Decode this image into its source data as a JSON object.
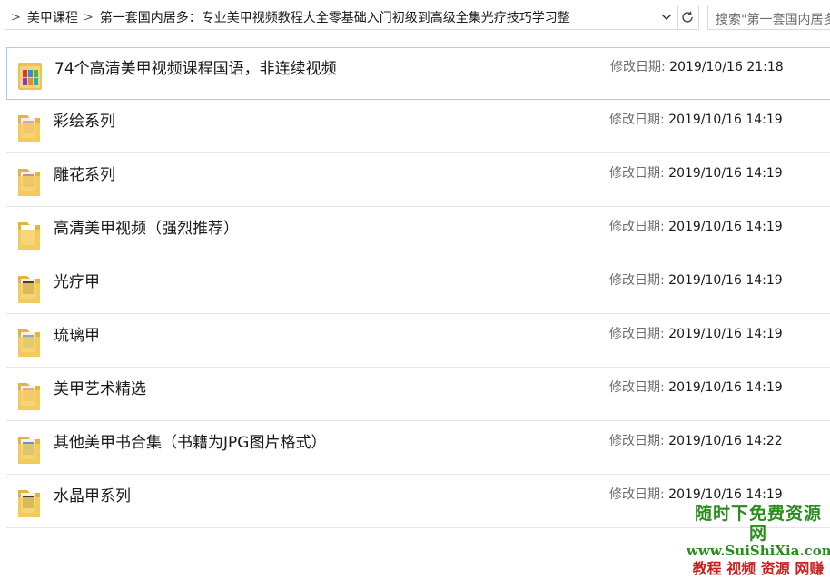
{
  "address_bar": {
    "breadcrumbs": [
      "美甲课程",
      "第一套国内居多：专业美甲视频教程大全零基础入门初级到高级全集光疗技巧学习整"
    ]
  },
  "search": {
    "placeholder": "搜索\"第一套国内居多"
  },
  "modified_label": "修改日期:",
  "files": [
    {
      "name": "74个高清美甲视频课程国语，非连续视频",
      "modified": "2019/10/16 21:18",
      "icon": "video-folder-icon",
      "selected": true
    },
    {
      "name": "彩绘系列",
      "modified": "2019/10/16 14:19",
      "icon": "folder-icon"
    },
    {
      "name": "雕花系列",
      "modified": "2019/10/16 14:19",
      "icon": "folder-icon"
    },
    {
      "name": "高清美甲视频（强烈推荐）",
      "modified": "2019/10/16 14:19",
      "icon": "folder-icon"
    },
    {
      "name": "光疗甲",
      "modified": "2019/10/16 14:19",
      "icon": "folder-icon"
    },
    {
      "name": "琉璃甲",
      "modified": "2019/10/16 14:19",
      "icon": "folder-icon"
    },
    {
      "name": "美甲艺术精选",
      "modified": "2019/10/16 14:19",
      "icon": "folder-icon"
    },
    {
      "name": "其他美甲书合集（书籍为JPG图片格式）",
      "modified": "2019/10/16 14:22",
      "icon": "folder-icon"
    },
    {
      "name": "水晶甲系列",
      "modified": "2019/10/16 14:19",
      "icon": "folder-icon"
    }
  ],
  "watermark": {
    "line1": "随时下免费资源网",
    "line2": "www.SuiShiXia.com",
    "line3": "教程 视频 资源 网赚"
  }
}
